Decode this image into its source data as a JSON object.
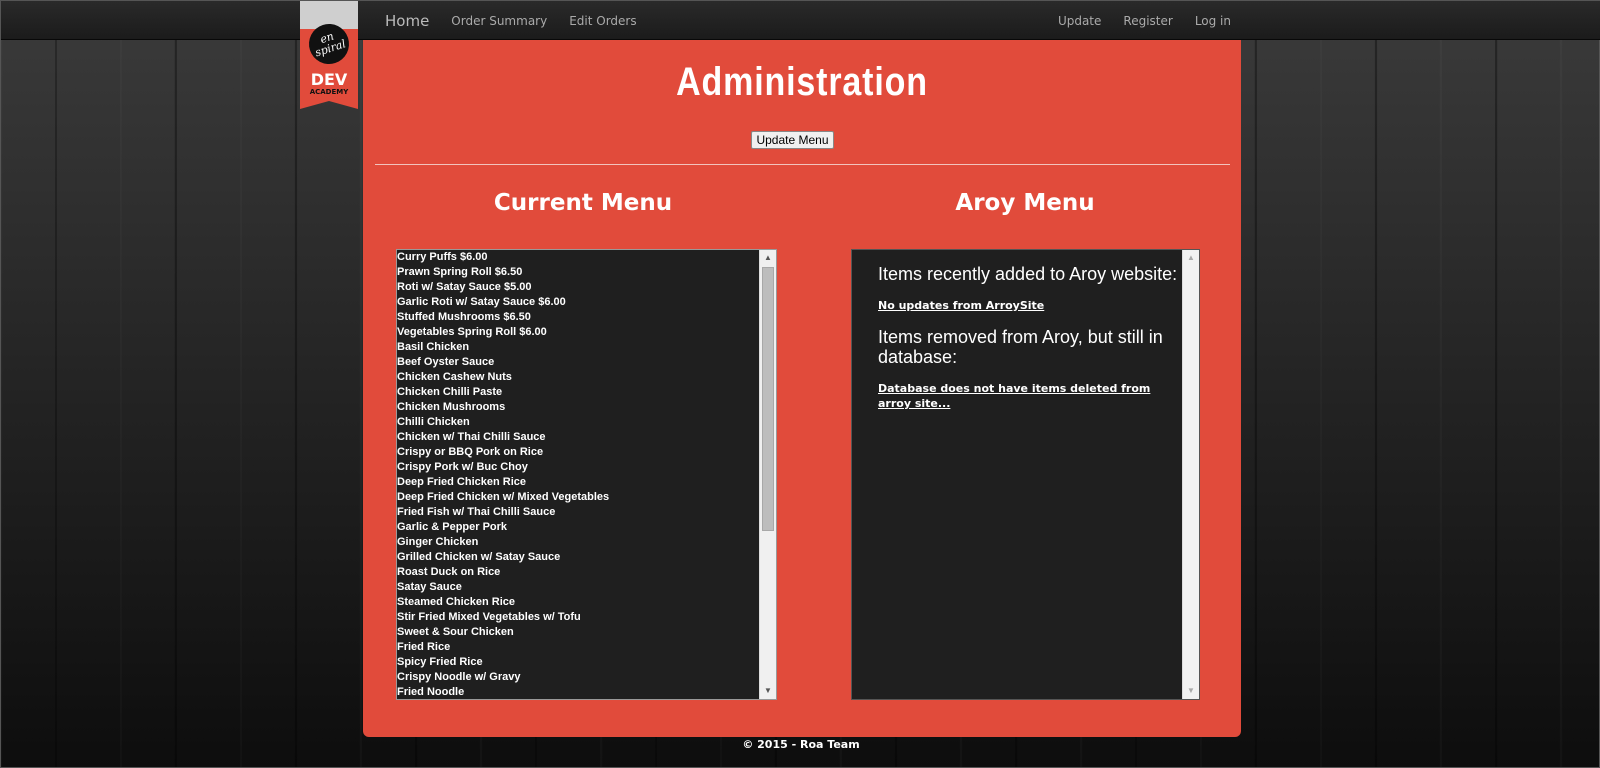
{
  "nav": {
    "home": "Home",
    "order_summary": "Order Summary",
    "edit_orders": "Edit Orders",
    "update": "Update",
    "register": "Register",
    "login": "Log in"
  },
  "logo": {
    "circle_text": "en spiral",
    "dev": "DEV",
    "academy": "ACADEMY"
  },
  "page": {
    "title": "Administration",
    "update_button": "Update Menu"
  },
  "current_menu": {
    "title": "Current Menu",
    "items": [
      "Curry Puffs $6.00",
      "Prawn Spring Roll $6.50",
      "Roti w/ Satay Sauce $5.00",
      "Garlic Roti w/ Satay Sauce $6.00",
      "Stuffed Mushrooms $6.50",
      "Vegetables Spring Roll $6.00",
      "Basil Chicken",
      "Beef Oyster Sauce",
      "Chicken Cashew Nuts",
      "Chicken Chilli Paste",
      "Chicken Mushrooms",
      "Chilli Chicken",
      "Chicken w/ Thai Chilli Sauce",
      "Crispy or BBQ Pork on Rice",
      "Crispy Pork w/ Buc Choy",
      "Deep Fried Chicken Rice",
      "Deep Fried Chicken w/ Mixed Vegetables",
      "Fried Fish w/ Thai Chilli Sauce",
      "Garlic & Pepper Pork",
      "Ginger Chicken",
      "Grilled Chicken w/ Satay Sauce",
      "Roast Duck on Rice",
      "Satay Sauce",
      "Steamed Chicken Rice",
      "Stir Fried Mixed Vegetables w/ Tofu",
      "Sweet & Sour Chicken",
      "Fried Rice",
      "Spicy Fried Rice",
      "Crispy Noodle w/ Gravy",
      "Fried Noodle"
    ]
  },
  "aroy_menu": {
    "title": "Aroy Menu",
    "added_heading": "Items recently added to Aroy website:",
    "added_note": "No updates from ArroySite",
    "removed_heading": "Items removed from Aroy, but still in database:",
    "removed_note": "Database does not have items deleted from arroy site..."
  },
  "footer": "© 2015 - Roa Team",
  "colors": {
    "accent": "#e14b3b",
    "navbar": "#1f1f1f",
    "box": "#1f1f1f"
  }
}
